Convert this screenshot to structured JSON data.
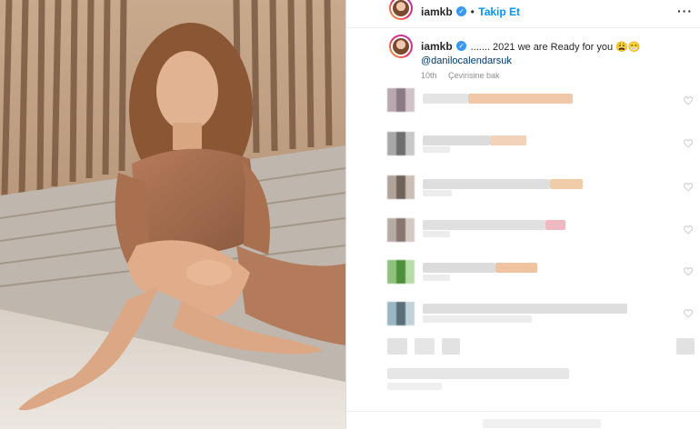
{
  "header": {
    "username": "iamkb",
    "separator": "•",
    "follow_label": "Takip Et",
    "more_label": "···"
  },
  "caption": {
    "username": "iamkb",
    "text": "....... 2021 we are Ready for you 😩😁",
    "mention": "@danilocalendarsuk",
    "time": "10th",
    "translate_label": "Çevirisine bak"
  },
  "colors": {
    "follow_blue": "#0095f6",
    "verified_blue": "#3897f0",
    "mention_blue": "#00376b",
    "muted_gray": "#8e8e8e"
  },
  "icons": [
    "verified-badge-icon",
    "more-options-icon",
    "heart-icon"
  ]
}
